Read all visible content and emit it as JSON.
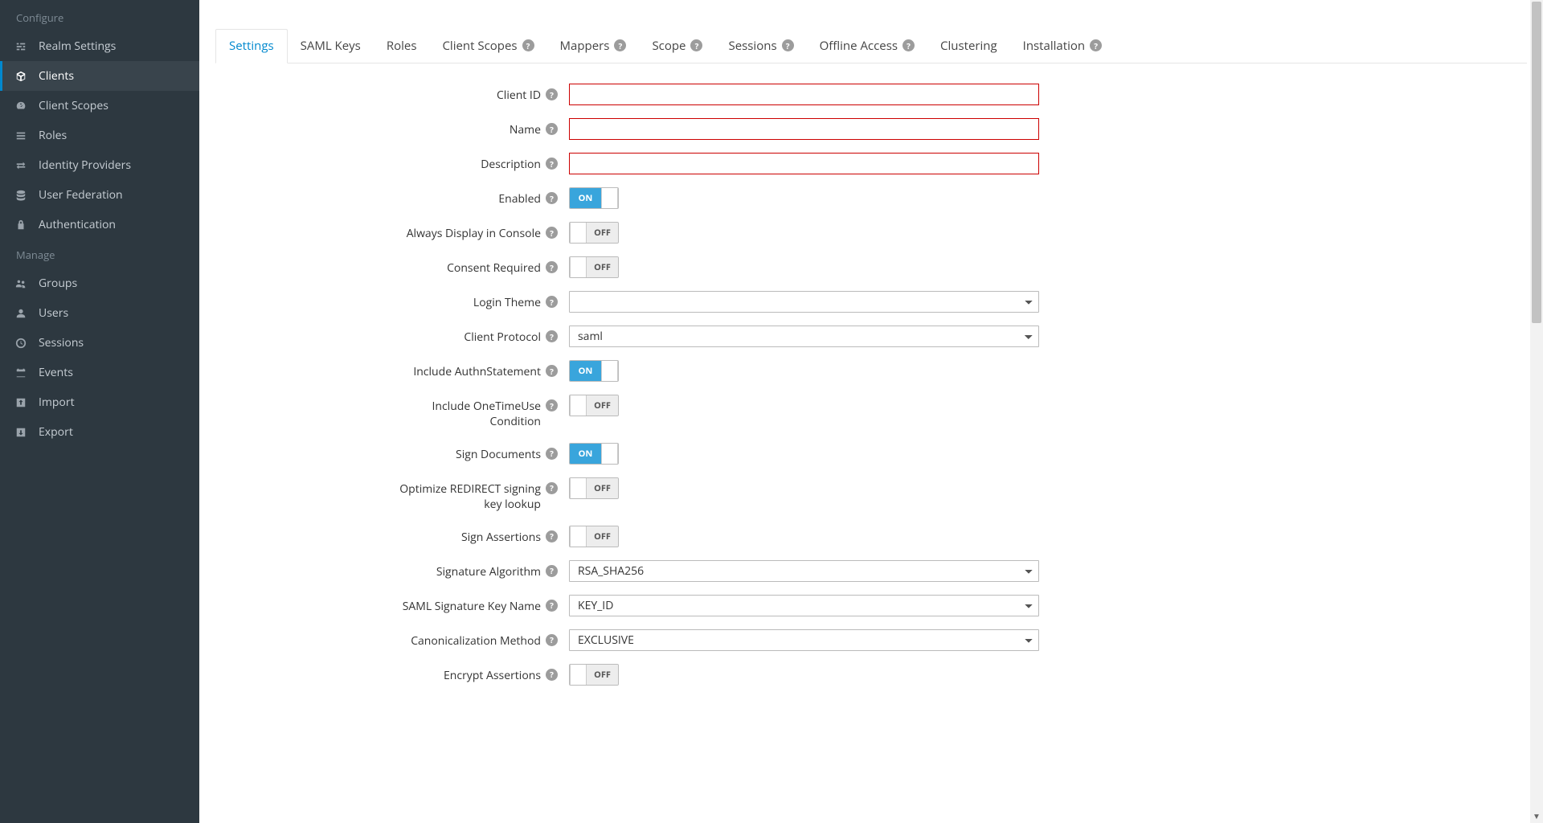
{
  "sidebar": {
    "sections": [
      {
        "header": "Configure",
        "items": [
          {
            "id": "realm-settings",
            "label": "Realm Settings",
            "icon": "sliders"
          },
          {
            "id": "clients",
            "label": "Clients",
            "icon": "cube",
            "active": true
          },
          {
            "id": "client-scopes",
            "label": "Client Scopes",
            "icon": "meter"
          },
          {
            "id": "roles",
            "label": "Roles",
            "icon": "list"
          },
          {
            "id": "identity-providers",
            "label": "Identity Providers",
            "icon": "exchange"
          },
          {
            "id": "user-federation",
            "label": "User Federation",
            "icon": "database"
          },
          {
            "id": "authentication",
            "label": "Authentication",
            "icon": "lock"
          }
        ]
      },
      {
        "header": "Manage",
        "items": [
          {
            "id": "groups",
            "label": "Groups",
            "icon": "users"
          },
          {
            "id": "users",
            "label": "Users",
            "icon": "user"
          },
          {
            "id": "sessions",
            "label": "Sessions",
            "icon": "clock"
          },
          {
            "id": "events",
            "label": "Events",
            "icon": "calendar"
          },
          {
            "id": "import",
            "label": "Import",
            "icon": "import"
          },
          {
            "id": "export",
            "label": "Export",
            "icon": "export"
          }
        ]
      }
    ]
  },
  "tabs": [
    {
      "label": "Settings",
      "active": true,
      "help": false
    },
    {
      "label": "SAML Keys",
      "help": false
    },
    {
      "label": "Roles",
      "help": false
    },
    {
      "label": "Client Scopes",
      "help": true
    },
    {
      "label": "Mappers",
      "help": true
    },
    {
      "label": "Scope",
      "help": true
    },
    {
      "label": "Sessions",
      "help": true
    },
    {
      "label": "Offline Access",
      "help": true
    },
    {
      "label": "Clustering",
      "help": false
    },
    {
      "label": "Installation",
      "help": true
    }
  ],
  "form": {
    "fields": [
      {
        "label": "Client ID",
        "type": "text",
        "value": "",
        "error": true
      },
      {
        "label": "Name",
        "type": "text",
        "value": "",
        "error": true
      },
      {
        "label": "Description",
        "type": "text",
        "value": "",
        "error": true
      },
      {
        "label": "Enabled",
        "type": "toggle",
        "value": "ON"
      },
      {
        "label": "Always Display in Console",
        "type": "toggle",
        "value": "OFF"
      },
      {
        "label": "Consent Required",
        "type": "toggle",
        "value": "OFF"
      },
      {
        "label": "Login Theme",
        "type": "select",
        "value": ""
      },
      {
        "label": "Client Protocol",
        "type": "select",
        "value": "saml"
      },
      {
        "label": "Include AuthnStatement",
        "type": "toggle",
        "value": "ON"
      },
      {
        "label": "Include OneTimeUse Condition",
        "type": "toggle",
        "value": "OFF"
      },
      {
        "label": "Sign Documents",
        "type": "toggle",
        "value": "ON"
      },
      {
        "label": "Optimize REDIRECT signing key lookup",
        "type": "toggle",
        "value": "OFF"
      },
      {
        "label": "Sign Assertions",
        "type": "toggle",
        "value": "OFF"
      },
      {
        "label": "Signature Algorithm",
        "type": "select",
        "value": "RSA_SHA256"
      },
      {
        "label": "SAML Signature Key Name",
        "type": "select",
        "value": "KEY_ID"
      },
      {
        "label": "Canonicalization Method",
        "type": "select",
        "value": "EXCLUSIVE"
      },
      {
        "label": "Encrypt Assertions",
        "type": "toggle",
        "value": "OFF"
      }
    ],
    "toggle_on_label": "ON",
    "toggle_off_label": "OFF"
  }
}
